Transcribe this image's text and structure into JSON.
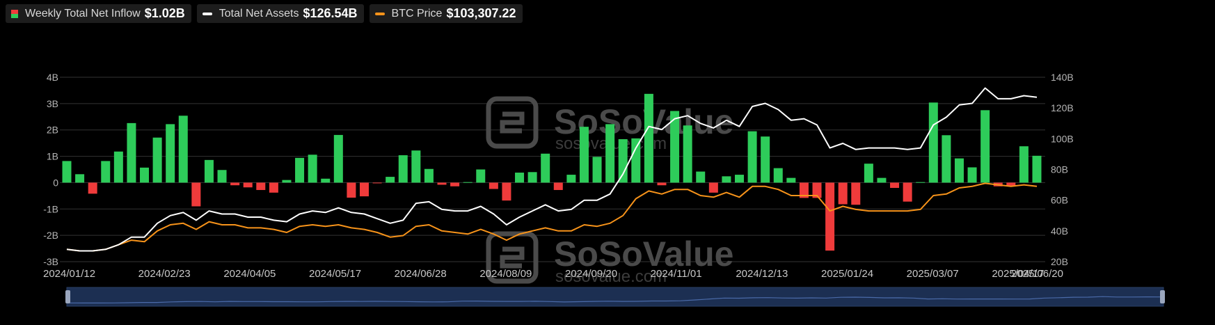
{
  "legend": [
    {
      "label": "Weekly Total Net Inflow",
      "value": "$1.02B"
    },
    {
      "label": "Total Net Assets",
      "value": "$126.54B"
    },
    {
      "label": "BTC Price",
      "value": "$103,307.22"
    }
  ],
  "watermark": {
    "brand": "SoSoValue",
    "site": "sosovalue.com"
  },
  "colors": {
    "positive": "#2ecc5a",
    "negative": "#ef3b3b",
    "assets_line": "#ffffff",
    "btc_line": "#f7931a",
    "grid": "#333333",
    "navigator": "#1c2f52"
  },
  "chart_data": {
    "type": "bar+line",
    "x_ticks": [
      "2024/01/12",
      "2024/02/23",
      "2024/04/05",
      "2024/05/17",
      "2024/06/28",
      "2024/08/09",
      "2024/09/20",
      "2024/11/01",
      "2024/12/13",
      "2025/01/24",
      "2025/03/07",
      "2025/04/17",
      "2025/06/20"
    ],
    "left_axis": {
      "ticks": [
        "4B",
        "3B",
        "2B",
        "1B",
        "0",
        "-1B",
        "-2B",
        "-3B"
      ],
      "range": [
        -3,
        4
      ],
      "unit": "B"
    },
    "right_axis": {
      "ticks": [
        "140B",
        "120B",
        "100B",
        "80B",
        "60B",
        "40B",
        "20B"
      ],
      "range": [
        20,
        140
      ],
      "unit": "B"
    },
    "grid": true,
    "legend_position": "top-left",
    "series": [
      {
        "name": "Weekly Total Net Inflow",
        "type": "bar",
        "axis": "left",
        "values": [
          0.82,
          0.32,
          -0.42,
          0.82,
          1.18,
          2.26,
          0.57,
          1.71,
          2.22,
          2.54,
          -0.9,
          0.86,
          0.48,
          -0.1,
          -0.18,
          -0.28,
          -0.38,
          0.1,
          0.94,
          1.06,
          0.15,
          1.81,
          -0.57,
          -0.52,
          -0.02,
          0.22,
          1.04,
          1.22,
          0.52,
          -0.08,
          -0.14,
          0.02,
          0.5,
          -0.24,
          -0.68,
          0.38,
          0.4,
          1.1,
          -0.28,
          0.3,
          2.12,
          0.98,
          2.22,
          1.65,
          1.68,
          3.37,
          -0.1,
          2.72,
          2.17,
          0.42,
          -0.38,
          0.24,
          0.3,
          1.95,
          1.75,
          0.55,
          0.18,
          -0.58,
          -0.58,
          -2.58,
          -0.82,
          -0.84,
          0.72,
          0.18,
          -0.2,
          -0.72,
          0.02,
          3.04,
          1.8,
          0.92,
          0.58,
          2.75,
          -0.14,
          -0.13,
          1.38,
          1.02
        ]
      },
      {
        "name": "Total Net Assets",
        "type": "line",
        "axis": "right",
        "values": [
          28,
          27,
          27,
          28,
          31,
          36,
          36,
          45,
          50,
          52,
          47,
          53,
          51,
          51,
          49,
          49,
          47,
          46,
          51,
          53,
          52,
          55,
          52,
          51,
          48,
          45,
          47,
          58,
          59,
          54,
          53,
          53,
          56,
          51,
          44,
          49,
          53,
          57,
          53,
          54,
          60,
          60,
          64,
          77,
          94,
          108,
          106,
          113,
          115,
          110,
          107,
          112,
          108,
          121,
          123,
          119,
          112,
          113,
          109,
          94,
          97,
          93,
          94,
          94,
          94,
          93,
          94,
          109,
          114,
          122,
          123,
          133,
          126,
          126,
          128,
          127
        ]
      },
      {
        "name": "BTC Price",
        "type": "line",
        "axis": "right",
        "values": [
          28,
          27,
          27,
          28,
          31,
          34,
          33,
          40,
          44,
          45,
          41,
          46,
          44,
          44,
          42,
          42,
          41,
          39,
          43,
          44,
          43,
          44,
          42,
          41,
          39,
          36,
          37,
          43,
          44,
          40,
          39,
          38,
          41,
          38,
          34,
          38,
          40,
          42,
          40,
          40,
          44,
          43,
          45,
          50,
          61,
          66,
          64,
          67,
          67,
          63,
          62,
          65,
          62,
          69,
          69,
          67,
          63,
          63,
          63,
          53,
          56,
          54,
          53,
          53,
          53,
          53,
          54,
          63,
          64,
          68,
          69,
          71,
          70,
          69,
          70,
          69
        ]
      }
    ]
  }
}
